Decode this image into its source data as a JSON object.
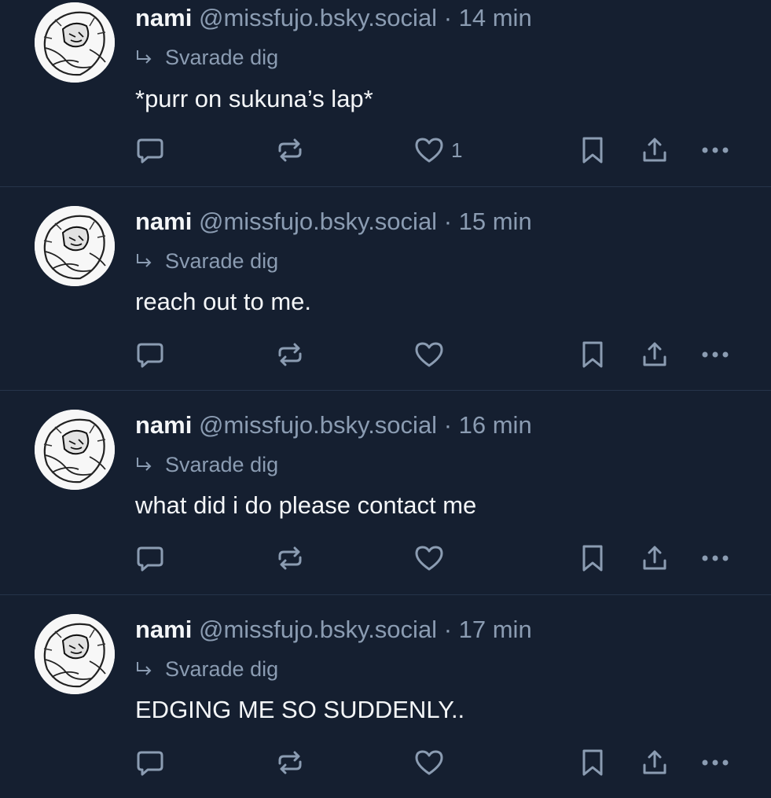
{
  "posts": [
    {
      "display_name": "nami",
      "handle": "@missfujo.bsky.social",
      "time": "· 14 min",
      "reply_label": "Svarade dig",
      "text": "*purr on sukuna’s lap*",
      "like_count": "1"
    },
    {
      "display_name": "nami",
      "handle": "@missfujo.bsky.social",
      "time": "· 15 min",
      "reply_label": "Svarade dig",
      "text": "reach out to me.",
      "like_count": ""
    },
    {
      "display_name": "nami",
      "handle": "@missfujo.bsky.social",
      "time": "· 16 min",
      "reply_label": "Svarade dig",
      "text": "what did i do please contact me",
      "like_count": ""
    },
    {
      "display_name": "nami",
      "handle": "@missfujo.bsky.social",
      "time": "· 17 min",
      "reply_label": "Svarade dig",
      "text": "EDGING ME SO SUDDENLY..",
      "like_count": ""
    }
  ],
  "icons": {
    "reply": "comment-bubble-icon",
    "repost": "repost-arrows-icon",
    "like": "heart-icon",
    "bookmark": "bookmark-icon",
    "share": "share-icon",
    "more": "more-dots-icon",
    "reply_indicator": "reply-arrow-icon"
  },
  "colors": {
    "background": "#151f30",
    "divider": "#26344a",
    "primary_text": "#f4f6f8",
    "secondary_text": "#8b9cb2"
  }
}
